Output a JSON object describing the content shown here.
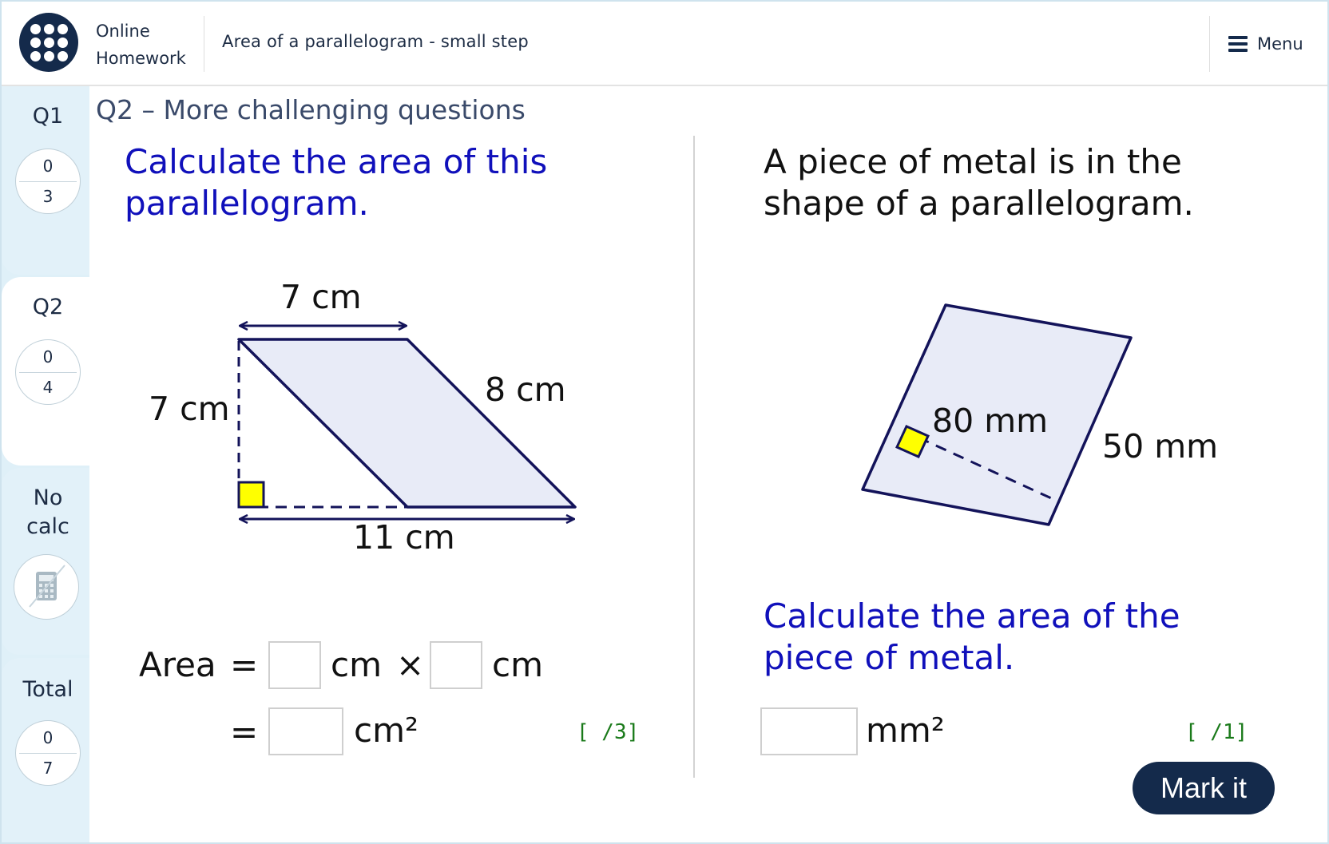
{
  "header": {
    "brand_line1": "Online",
    "brand_line2": "Homework",
    "page_title": "Area of a parallelogram - small step",
    "menu_label": "Menu"
  },
  "sidebar": {
    "q1": {
      "label": "Q1",
      "score": "0",
      "total": "3"
    },
    "q2": {
      "label": "Q2",
      "score": "0",
      "total": "4"
    },
    "calc": {
      "line1": "No",
      "line2": "calc",
      "icon": "no-calculator-icon"
    },
    "total": {
      "label": "Total",
      "score": "0",
      "total": "7"
    }
  },
  "main": {
    "section_title": "Q2 – More challenging questions",
    "left": {
      "prompt_line1": "Calculate the area of this",
      "prompt_line2": "parallelogram.",
      "labels": {
        "top": "7 cm",
        "height": "7 cm",
        "side": "8 cm",
        "base": "11 cm"
      },
      "area_label": "Area",
      "equals": "=",
      "unit_cm": "cm",
      "times": "×",
      "unit_cm2": "cm²",
      "box1_value": "",
      "box2_value": "",
      "box3_value": "",
      "marks": "[ /3]"
    },
    "right": {
      "prompt_line1": "A piece of metal is in the",
      "prompt_line2": "shape of a parallelogram.",
      "labels": {
        "height": "80 mm",
        "side": "50 mm"
      },
      "question_line1": "Calculate the area of the",
      "question_line2": "piece of metal.",
      "unit_mm2": "mm²",
      "box_value": "",
      "marks": "[ /1]"
    },
    "mark_button": "Mark it"
  },
  "colors": {
    "navy": "#142a4b",
    "prompt_blue": "#1010bb",
    "shape_fill": "#e8ebf7",
    "shape_stroke": "#13135a",
    "right_angle": "#ffff00",
    "marks_green": "#1a7a1a",
    "sidebar_bg": "#dff0f8"
  }
}
